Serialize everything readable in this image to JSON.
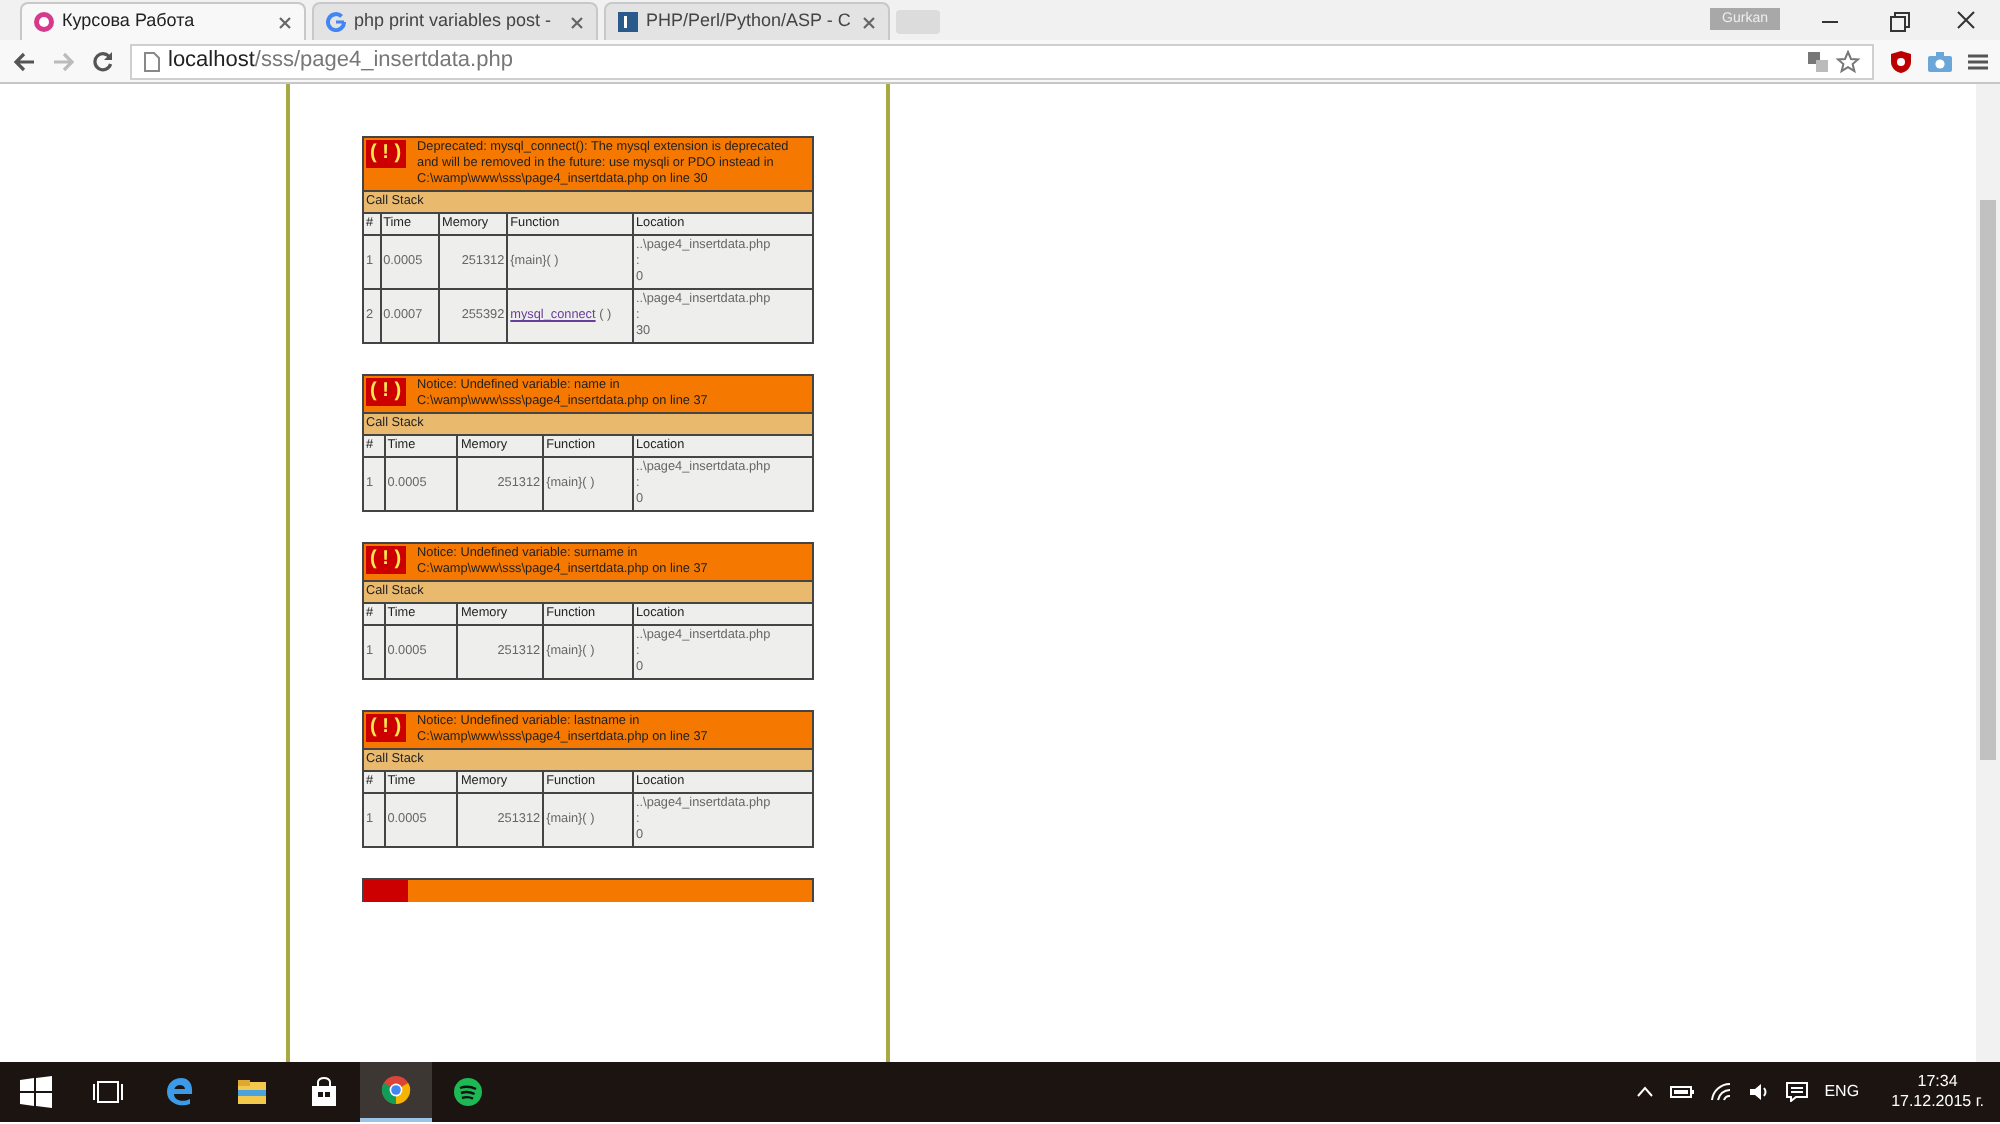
{
  "browser": {
    "tabs": [
      {
        "title": "Курсова Работа",
        "selected": true
      },
      {
        "title": "php print variables post -",
        "selected": false
      },
      {
        "title": "PHP/Perl/Python/ASP - C",
        "selected": false
      }
    ],
    "profile": "Gurkan",
    "url_host": "localhost",
    "url_path": "/sss/page4_insertdata.php"
  },
  "errors": [
    {
      "kind": "full",
      "badge": "( ! )",
      "message": "Deprecated: mysql_connect(): The mysql extension is deprecated and will be removed in the future: use mysqli or PDO instead in C:\\wamp\\www\\sss\\page4_insertdata.php on line 30",
      "stack_title": "Call Stack",
      "columns": [
        "#",
        "Time",
        "Memory",
        "Function",
        "Location"
      ],
      "rows": [
        {
          "num": "1",
          "time": "0.0005",
          "memory": "251312",
          "function": "{main}",
          "link": false,
          "args": "( )",
          "file": "..\\page4_insertdata.php",
          "sep": ":",
          "line": "0"
        },
        {
          "num": "2",
          "time": "0.0007",
          "memory": "255392",
          "function": "mysql_connect",
          "link": true,
          "args": "( )",
          "file": "..\\page4_insertdata.php",
          "sep": ":",
          "line": "30"
        }
      ]
    },
    {
      "kind": "full",
      "badge": "( ! )",
      "message": "Notice: Undefined variable: name in C:\\wamp\\www\\sss\\page4_insertdata.php on line 37",
      "stack_title": "Call Stack",
      "columns": [
        "#",
        "Time",
        "Memory",
        "Function",
        "Location"
      ],
      "rows": [
        {
          "num": "1",
          "time": "0.0005",
          "memory": "251312",
          "function": "{main}",
          "link": false,
          "args": "( )",
          "file": "..\\page4_insertdata.php",
          "sep": ":",
          "line": "0"
        }
      ]
    },
    {
      "kind": "full",
      "badge": "( ! )",
      "message": "Notice: Undefined variable: surname in C:\\wamp\\www\\sss\\page4_insertdata.php on line 37",
      "stack_title": "Call Stack",
      "columns": [
        "#",
        "Time",
        "Memory",
        "Function",
        "Location"
      ],
      "rows": [
        {
          "num": "1",
          "time": "0.0005",
          "memory": "251312",
          "function": "{main}",
          "link": false,
          "args": "( )",
          "file": "..\\page4_insertdata.php",
          "sep": ":",
          "line": "0"
        }
      ]
    },
    {
      "kind": "full",
      "badge": "( ! )",
      "message": "Notice: Undefined variable: lastname in C:\\wamp\\www\\sss\\page4_insertdata.php on line 37",
      "stack_title": "Call Stack",
      "columns": [
        "#",
        "Time",
        "Memory",
        "Function",
        "Location"
      ],
      "rows": [
        {
          "num": "1",
          "time": "0.0005",
          "memory": "251312",
          "function": "{main}",
          "link": false,
          "args": "( )",
          "file": "..\\page4_insertdata.php",
          "sep": ":",
          "line": "0"
        }
      ]
    },
    {
      "kind": "cut"
    }
  ],
  "taskbar": {
    "apps": [
      {
        "active": false
      },
      {
        "active": false
      },
      {
        "active": false
      },
      {
        "active": false
      },
      {
        "active": true
      },
      {
        "active": false
      }
    ],
    "language": "ENG",
    "time": "17:34",
    "date": "17.12.2015 г."
  }
}
